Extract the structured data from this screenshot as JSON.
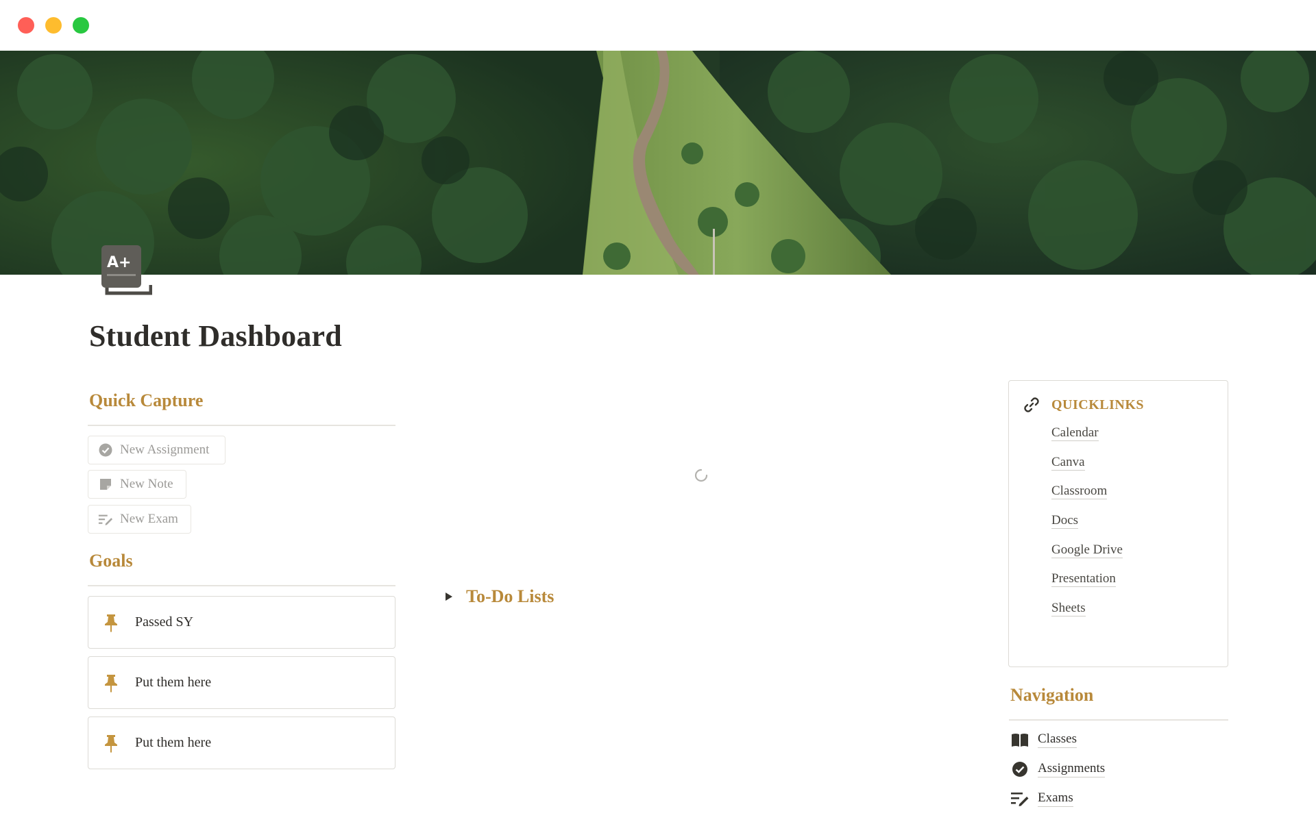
{
  "window": {
    "controls": [
      "close",
      "minimize",
      "maximize"
    ]
  },
  "page": {
    "title": "Student Dashboard",
    "icon": "a-plus-grade-icon",
    "accent_color": "#b8893a"
  },
  "quick_capture": {
    "heading": "Quick Capture",
    "buttons": [
      {
        "label": "New Assignment",
        "icon": "check-circle-icon"
      },
      {
        "label": "New Note",
        "icon": "note-icon"
      },
      {
        "label": "New Exam",
        "icon": "edit-list-icon"
      }
    ]
  },
  "goals": {
    "heading": "Goals",
    "items": [
      {
        "label": "Passed SY",
        "icon": "pin-icon"
      },
      {
        "label": "Put them here",
        "icon": "pin-icon"
      },
      {
        "label": "Put them here",
        "icon": "pin-icon"
      }
    ]
  },
  "todo": {
    "label": "To-Do Lists",
    "collapsed": true
  },
  "quicklinks": {
    "title": "QUICKLINKS",
    "icon": "link-icon",
    "links": [
      "Calendar",
      "Canva",
      "Classroom",
      "Docs",
      "Google Drive",
      "Presentation",
      "Sheets"
    ]
  },
  "navigation": {
    "heading": "Navigation",
    "items": [
      {
        "label": "Classes",
        "icon": "book-icon"
      },
      {
        "label": "Assignments",
        "icon": "check-circle-icon"
      },
      {
        "label": "Exams",
        "icon": "edit-list-icon"
      }
    ]
  }
}
